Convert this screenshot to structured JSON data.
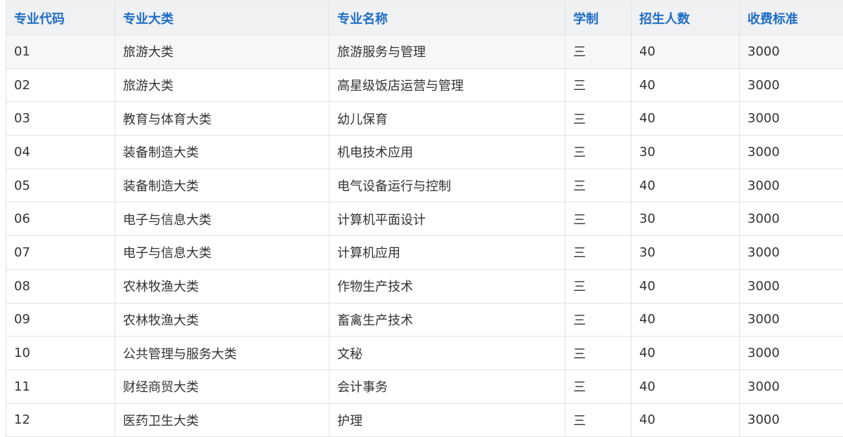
{
  "table": {
    "headers": [
      "专业代码",
      "专业大类",
      "专业名称",
      "学制",
      "招生人数",
      "收费标准"
    ],
    "rows": [
      [
        "01",
        "旅游大类",
        "旅游服务与管理",
        "三",
        "40",
        "3000"
      ],
      [
        "02",
        "旅游大类",
        "高星级饭店运营与管理",
        "三",
        "40",
        "3000"
      ],
      [
        "03",
        "教育与体育大类",
        "幼儿保育",
        "三",
        "40",
        "3000"
      ],
      [
        "04",
        "装备制造大类",
        "机电技术应用",
        "三",
        "30",
        "3000"
      ],
      [
        "05",
        "装备制造大类",
        "电气设备运行与控制",
        "三",
        "40",
        "3000"
      ],
      [
        "06",
        "电子与信息大类",
        "计算机平面设计",
        "三",
        "30",
        "3000"
      ],
      [
        "07",
        "电子与信息大类",
        "计算机应用",
        "三",
        "30",
        "3000"
      ],
      [
        "08",
        "农林牧渔大类",
        "作物生产技术",
        "三",
        "40",
        "3000"
      ],
      [
        "09",
        "农林牧渔大类",
        "畜禽生产技术",
        "三",
        "40",
        "3000"
      ],
      [
        "10",
        "公共管理与服务大类",
        "文秘",
        "三",
        "40",
        "3000"
      ],
      [
        "11",
        "财经商贸大类",
        "会计事务",
        "三",
        "40",
        "3000"
      ],
      [
        "12",
        "医药卫生大类",
        "护理",
        "三",
        "40",
        "3000"
      ]
    ]
  },
  "colors": {
    "header_text": "#1f6dc6",
    "header_bg": "#f0f1f3",
    "cell_text": "#333333",
    "border": "#e2e2e2",
    "first_row_bg": "#f7f7f7"
  }
}
